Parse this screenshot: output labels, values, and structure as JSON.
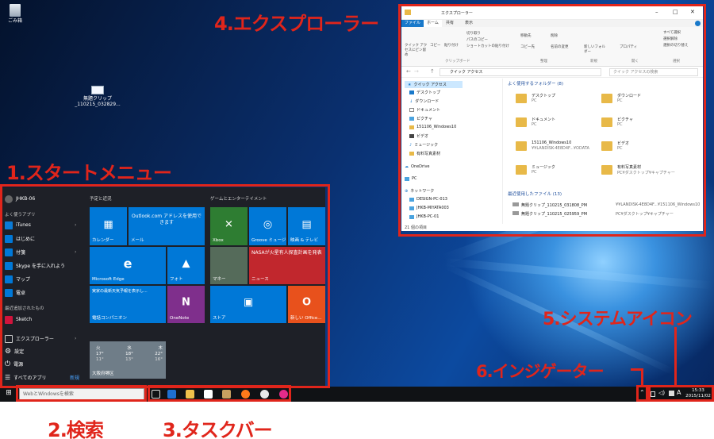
{
  "callouts": {
    "explorer": "4.エクスプローラー",
    "start_menu": "1.スタートメニュー",
    "search": "2.検索",
    "taskbar": "3.タスクバー",
    "system_icons": "5.システムアイコン",
    "indicator": "6.インジゲーター"
  },
  "desktop": {
    "recycle_bin": "ごみ箱",
    "screenshot_icon_line1": "無題クリップ",
    "screenshot_icon_line2": "_110215_032829..."
  },
  "start_menu": {
    "user": "JHKB-06",
    "most_used_header": "よく使うアプリ",
    "most_used": [
      "iTunes",
      "はじめに",
      "付箋",
      "Skype を手に入れよう",
      "マップ",
      "電卓"
    ],
    "recent_header": "最近追加されたもの",
    "recent": [
      "Sketch"
    ],
    "bottom": [
      "エクスプローラー",
      "設定",
      "電源",
      "すべてのアプリ"
    ],
    "new_badge": "新規",
    "group1_header": "予定と近況",
    "group2_header": "ゲームとエンターテイメント",
    "tiles": {
      "calendar": "カレンダー",
      "mail_text": "Outlook.com アドレスを使用できます",
      "mail": "メール",
      "edge": "Microsoft Edge",
      "photos": "フォト",
      "weather_text": "実家の最新天気予報を表示し...",
      "companion": "電話コンパニオン",
      "onenote": "OneNote",
      "xbox": "Xbox",
      "groove": "Groove ミュージ...",
      "movies": "映画 & テレビ",
      "money": "マネー",
      "news_text": "NASAが火星有人探査計画を発表",
      "news": "ニュース",
      "store": "ストア",
      "office": "新しい Office...",
      "weather_days": [
        "火",
        "水",
        "木"
      ],
      "weather_high": [
        "17°",
        "18°",
        "22°"
      ],
      "weather_low": [
        "11°",
        "13°",
        "16°"
      ],
      "weather_city": "大阪府堺区"
    }
  },
  "taskbar": {
    "search_placeholder": "WebとWindowsを検索",
    "ime": "A",
    "time": "15:33",
    "date": "2015/11/02"
  },
  "explorer": {
    "title": "エクスプローラー",
    "tabs": [
      "ファイル",
      "ホーム",
      "共有",
      "表示"
    ],
    "ribbon_groups": [
      "クリップボード",
      "整理",
      "新規",
      "開く",
      "選択"
    ],
    "ribbon_items": {
      "pin": "クイック アクセスにピン留め",
      "copy": "コピー",
      "paste": "貼り付け",
      "cut": "切り取り",
      "copy_path": "パスのコピー",
      "paste_shortcut": "ショートカットの貼り付け",
      "move_to": "移動先",
      "delete": "削除",
      "copy_to": "コピー先",
      "rename": "名前の変更",
      "new_folder": "新しいフォルダー",
      "properties": "プロパティ",
      "select_all": "すべて選択",
      "select_none": "選択解除",
      "invert": "選択の切り替え"
    },
    "address": "クイック アクセス",
    "search_placeholder": "クイック アクセスの検索",
    "nav": [
      "クイック アクセス",
      "デスクトップ",
      "ダウンロード",
      "ドキュメント",
      "ピクチャ",
      "151106_Windows10",
      "ビデオ",
      "ミュージック",
      "有料写真素材",
      "OneDrive",
      "PC",
      "ネットワーク",
      "DESIGN-PC-013",
      "JHKB-MIYATA003",
      "JHKB-PC-01"
    ],
    "frequent_header": "よく使用するフォルダー (8)",
    "frequent": [
      {
        "name": "デスクトップ",
        "loc": "PC"
      },
      {
        "name": "ダウンロード",
        "loc": "PC"
      },
      {
        "name": "ドキュメント",
        "loc": "PC"
      },
      {
        "name": "ピクチャ",
        "loc": "PC"
      },
      {
        "name": "151106_Windows10",
        "loc": "¥¥LANDISK-4E8D4F...¥ODATA"
      },
      {
        "name": "ビデオ",
        "loc": "PC"
      },
      {
        "name": "ミュージック",
        "loc": "PC"
      },
      {
        "name": "有料写真素材",
        "loc": "PC¥ダスクトップ¥キャプチャー"
      }
    ],
    "recent_header": "最近使用したファイル (13)",
    "recent": [
      {
        "name": "無題クリップ_110215_031808_PM",
        "loc": "¥¥LANDISK-4E8D4F...¥151106_Windows10"
      },
      {
        "name": "無題クリップ_110215_025959_PM",
        "loc": "PC¥ダスクトップ¥キャプチャー"
      }
    ],
    "status": "21 個の項目"
  },
  "colors": {
    "accent": "#0078d7",
    "callout": "#e0251b",
    "start_bg": "#1e2027"
  }
}
